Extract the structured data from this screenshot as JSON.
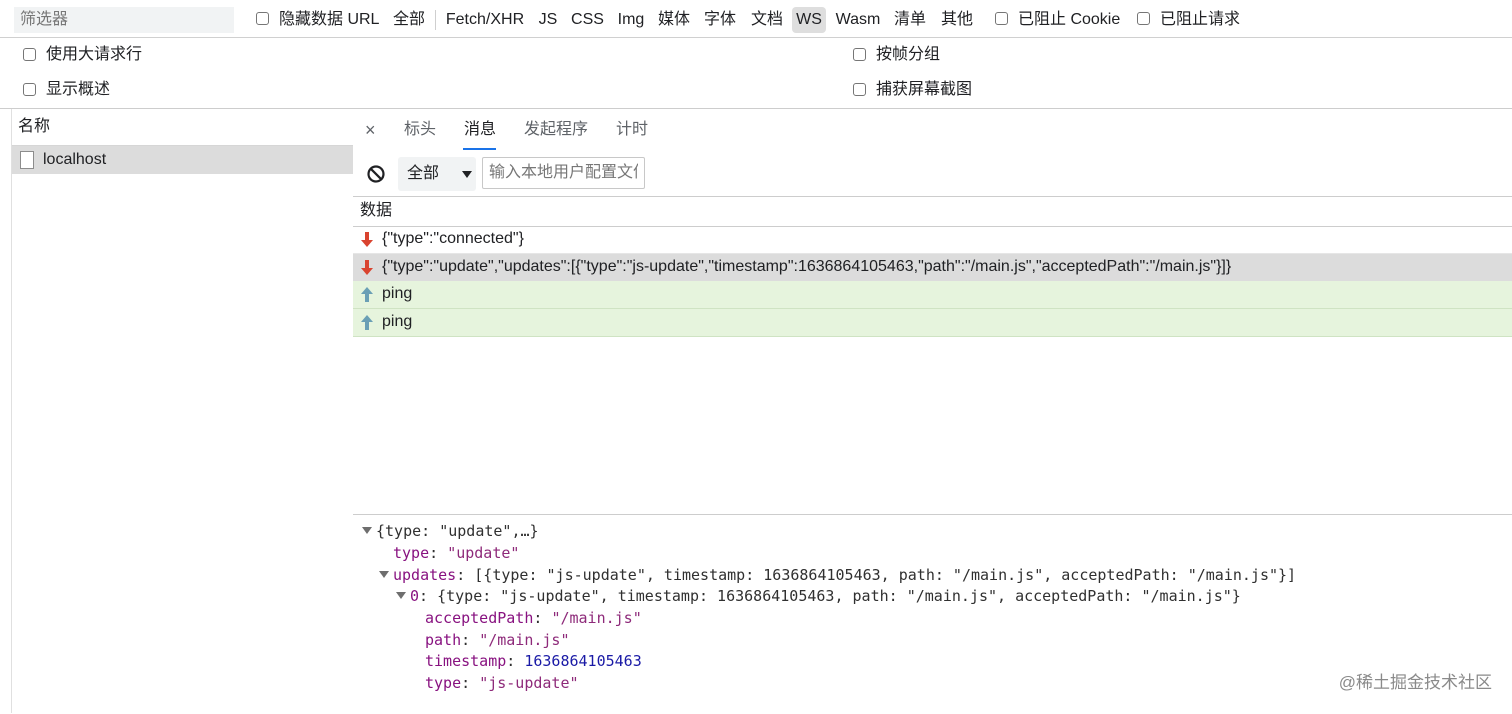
{
  "toolbar": {
    "filter_placeholder": "筛选器",
    "hide_data_url_label": "隐藏数据 URL",
    "type_filters": [
      "全部",
      "Fetch/XHR",
      "JS",
      "CSS",
      "Img",
      "媒体",
      "字体",
      "文档",
      "WS",
      "Wasm",
      "清单",
      "其他"
    ],
    "active_type": "WS",
    "blocked_cookies_label": "已阻止 Cookie",
    "blocked_requests_label": "已阻止请求"
  },
  "options": {
    "large_rows_label": "使用大请求行",
    "group_by_frame_label": "按帧分组",
    "show_overview_label": "显示概述",
    "capture_screenshots_label": "捕获屏幕截图"
  },
  "requests": {
    "header_name": "名称",
    "items": [
      {
        "name": "localhost"
      }
    ]
  },
  "details": {
    "close_glyph": "×",
    "tabs": [
      "标头",
      "消息",
      "发起程序",
      "计时"
    ],
    "active_tab": "消息",
    "message_filter_select": "全部",
    "message_filter_placeholder": "输入本地用户配置文件",
    "data_column": "数据",
    "messages": [
      {
        "direction": "received",
        "data": "{\"type\":\"connected\"}"
      },
      {
        "direction": "received",
        "data": "{\"type\":\"update\",\"updates\":[{\"type\":\"js-update\",\"timestamp\":1636864105463,\"path\":\"/main.js\",\"acceptedPath\":\"/main.js\"}]}"
      },
      {
        "direction": "sent",
        "data": "ping"
      },
      {
        "direction": "sent",
        "data": "ping"
      }
    ]
  },
  "inspector": {
    "root_summary": "{type: \"update\",…}",
    "type_key": "type",
    "type_value": "\"update\"",
    "updates_key": "updates",
    "updates_summary": "[{type: \"js-update\", timestamp: 1636864105463, path: \"/main.js\", acceptedPath: \"/main.js\"}]",
    "item_key": "0",
    "item_summary": "{type: \"js-update\", timestamp: 1636864105463, path: \"/main.js\", acceptedPath: \"/main.js\"}",
    "acceptedPath_key": "acceptedPath",
    "acceptedPath_value": "\"/main.js\"",
    "path_key": "path",
    "path_value": "\"/main.js\"",
    "timestamp_key": "timestamp",
    "timestamp_value": "1636864105463",
    "item_type_key": "type",
    "item_type_value": "\"js-update\""
  },
  "watermark": "@稀土掘金技术社区",
  "colors": {
    "received_arrow": "#d9432f",
    "sent_arrow": "#6a9fb5",
    "sent_row_bg": "#e6f4dd",
    "tab_underline": "#1a73e8"
  }
}
